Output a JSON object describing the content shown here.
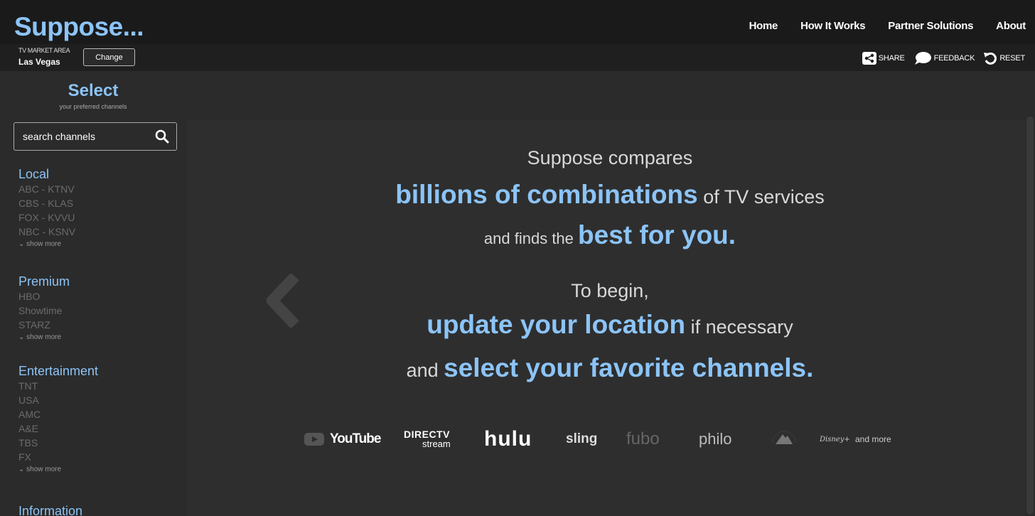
{
  "brand": {
    "logo": "Suppose..."
  },
  "nav": {
    "links": [
      "Home",
      "How It Works",
      "Partner Solutions",
      "About"
    ]
  },
  "market": {
    "label": "TV MARKET AREA",
    "city": "Las Vegas",
    "change_label": "Change"
  },
  "actions": {
    "share": "SHARE",
    "feedback": "FEEDBACK",
    "reset": "RESET"
  },
  "sidebar": {
    "title": "Select",
    "subtitle": "your preferred channels",
    "search_placeholder": "search channels",
    "show_more": "show more",
    "categories": [
      {
        "name": "Local",
        "channels": [
          "ABC - KTNV",
          "CBS - KLAS",
          "FOX - KVVU",
          "NBC - KSNV"
        ]
      },
      {
        "name": "Premium",
        "channels": [
          "HBO",
          "Showtime",
          "STARZ"
        ]
      },
      {
        "name": "Entertainment",
        "channels": [
          "TNT",
          "USA",
          "AMC",
          "A&E",
          "TBS",
          "FX"
        ]
      },
      {
        "name": "Information",
        "channels": []
      }
    ]
  },
  "hero": {
    "l1": "Suppose compares",
    "l2_big": "billions of combinations",
    "l2_rest": " of TV services",
    "l3_pre": "and finds the ",
    "l3_big": "best for you.",
    "l4": "To begin,",
    "l5_big": "update your location",
    "l5_rest": " if necessary",
    "l6_pre": "and ",
    "l6_big": "select your favorite channels."
  },
  "services": {
    "youtube": "YouTube",
    "directv_top": "DIRECTV",
    "directv_bottom": "stream",
    "hulu": "hulu",
    "sling": "sling",
    "fubo": "fubo",
    "philo": "philo",
    "disney": "Disney+",
    "and_more": "and more"
  },
  "colors": {
    "accent": "#8cc4f7",
    "background": "#2b2b2b",
    "topbar": "#1a1a1a",
    "muted_channel": "#6b6b6b"
  }
}
